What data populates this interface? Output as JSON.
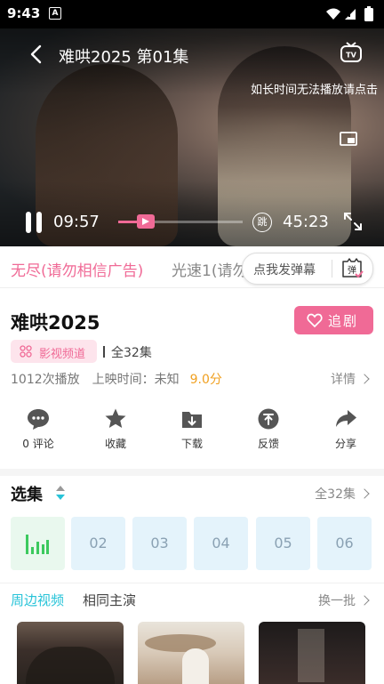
{
  "status_bar": {
    "time": "9:43",
    "app_icon": "A"
  },
  "player": {
    "title": "难哄2025  第01集",
    "notice": "如长时间无法播放请点击",
    "current_time": "09:57",
    "duration": "45:23",
    "progress": 0.22,
    "skip_label": "跳"
  },
  "sources": {
    "active": "无尽(请勿相信广告)",
    "other": "光速1(请勿"
  },
  "danmu": {
    "label": "点我发弹幕",
    "icon_label": "弹"
  },
  "show": {
    "title": "难哄2025",
    "follow_label": "追剧",
    "tag": "影视频道",
    "episodes_total": "全32集",
    "plays": "1012次播放",
    "release": "上映时间：未知",
    "score": "9.0分",
    "detail_label": "详情"
  },
  "actions": [
    {
      "label": "0 评论",
      "icon": "comment-icon"
    },
    {
      "label": "收藏",
      "icon": "star-icon"
    },
    {
      "label": "下载",
      "icon": "download-icon"
    },
    {
      "label": "反馈",
      "icon": "feedback-icon"
    },
    {
      "label": "分享",
      "icon": "share-icon"
    }
  ],
  "episodes": {
    "title": "选集",
    "all_label": "全32集",
    "items": [
      "01",
      "02",
      "03",
      "04",
      "05",
      "06"
    ],
    "playing_index": 0
  },
  "recommend": {
    "tab_active": "周边视频",
    "tab_other": "相同主演",
    "more_label": "换一批"
  },
  "colors": {
    "accent": "#f06a96",
    "playing": "#3cc95e",
    "tab_active": "#27c3d8",
    "score": "#f0a020"
  }
}
